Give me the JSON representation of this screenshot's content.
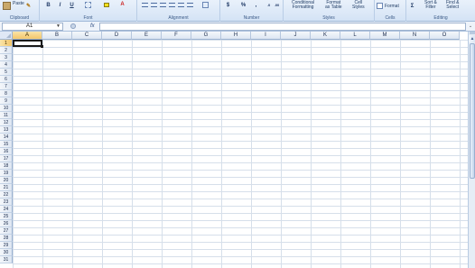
{
  "ribbon": {
    "clipboard": {
      "group_label": "Clipboard",
      "paste_label": "Paste"
    },
    "font": {
      "group_label": "Font",
      "bold": "B",
      "italic": "I",
      "underline": "U",
      "font_color_glyph": "A"
    },
    "alignment": {
      "group_label": "Alignment"
    },
    "number": {
      "group_label": "Number",
      "currency": "$",
      "percent": "%",
      "comma": ","
    },
    "styles": {
      "group_label": "Styles",
      "conditional_formatting": [
        "Conditional",
        "Formatting"
      ],
      "format_as_table": [
        "Format",
        "as Table"
      ],
      "cell_styles": [
        "Cell",
        "Styles"
      ]
    },
    "cells": {
      "group_label": "Cells",
      "format_label": "Format"
    },
    "editing": {
      "group_label": "Editing",
      "sort_filter": [
        "Sort &",
        "Filter"
      ],
      "find_select": [
        "Find &",
        "Select"
      ]
    }
  },
  "formula_bar": {
    "name_box": "A1",
    "fx_label": "fx",
    "value": ""
  },
  "grid": {
    "columns": [
      "A",
      "B",
      "C",
      "D",
      "E",
      "F",
      "G",
      "H",
      "I",
      "J",
      "K",
      "L",
      "M",
      "N",
      "O"
    ],
    "rows": [
      "1",
      "2",
      "3",
      "4",
      "5",
      "6",
      "7",
      "8",
      "9",
      "10",
      "11",
      "12",
      "13",
      "14",
      "15",
      "16",
      "17",
      "18",
      "19",
      "20",
      "21",
      "22",
      "23",
      "24",
      "25",
      "26",
      "27",
      "28",
      "29",
      "30",
      "31"
    ],
    "active_cell": "A1",
    "active_column": "A",
    "active_row": "1"
  },
  "colors": {
    "selection_header": "#f3c66b",
    "ribbon_bg": "#d4e3f5",
    "gridline": "#d6dfea"
  }
}
